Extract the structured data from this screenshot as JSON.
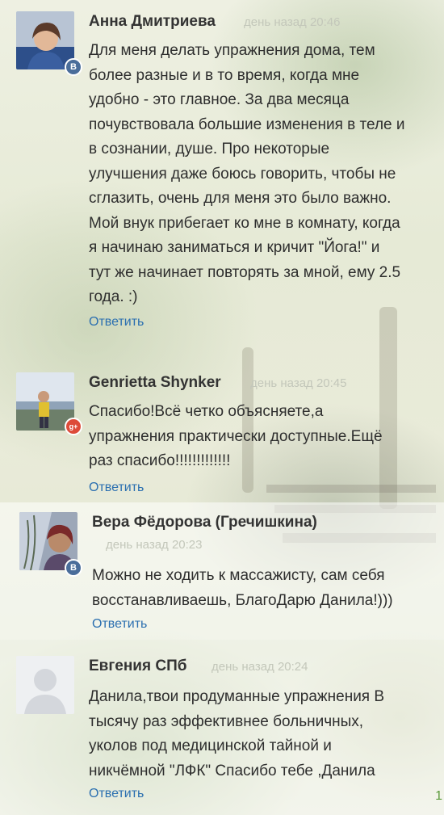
{
  "reply_label": "Ответить",
  "comments": [
    {
      "name": "Анна Дмитриева",
      "time": "день назад 20:46",
      "network": "vk",
      "network_badge": "B",
      "lines": [
        "Для меня делать упражнения дома, тем",
        "более разные и в то время, когда мне",
        "удобно - это главное. За два месяца",
        "почувствовала большие изменения в теле и",
        "в сознании, душе. Про некоторые",
        "улучшения даже боюсь говорить, чтобы не",
        "сглазить, очень для меня это было важно.",
        "Мой внук прибегает ко мне в комнату, когда",
        "я начинаю заниматься и кричит \"Йога!\" и",
        "тут же начинает повторять за мной, ему 2.5",
        "года. :)"
      ]
    },
    {
      "name": "Genrietta Shynker",
      "time": "день назад 20:45",
      "network": "gplus",
      "network_badge": "g+",
      "lines": [
        "Спасибо!Всё четко объясняете,а",
        "упражнения практически доступные.Ещё",
        "раз спасибо!!!!!!!!!!!!!"
      ]
    },
    {
      "name": "Вера Фёдорова (Гречишкина)",
      "time": "день назад 20:23",
      "network": "vk",
      "network_badge": "B",
      "lines": [
        "Можно не ходить к массажисту, сам себя",
        "восстанавливаешь, БлагоДарю Данила!)))"
      ]
    },
    {
      "name": "Евгения СПб",
      "time": "день назад 20:24",
      "network": "none",
      "lines": [
        "Данила,твои продуманные упражнения В",
        "тысячу раз эффективнее больничных,",
        "уколов  под  медицинской тайной и",
        "никчёмной \"ЛФК\" Спасибо тебе ,Данила"
      ]
    }
  ],
  "corner_marker": "1"
}
